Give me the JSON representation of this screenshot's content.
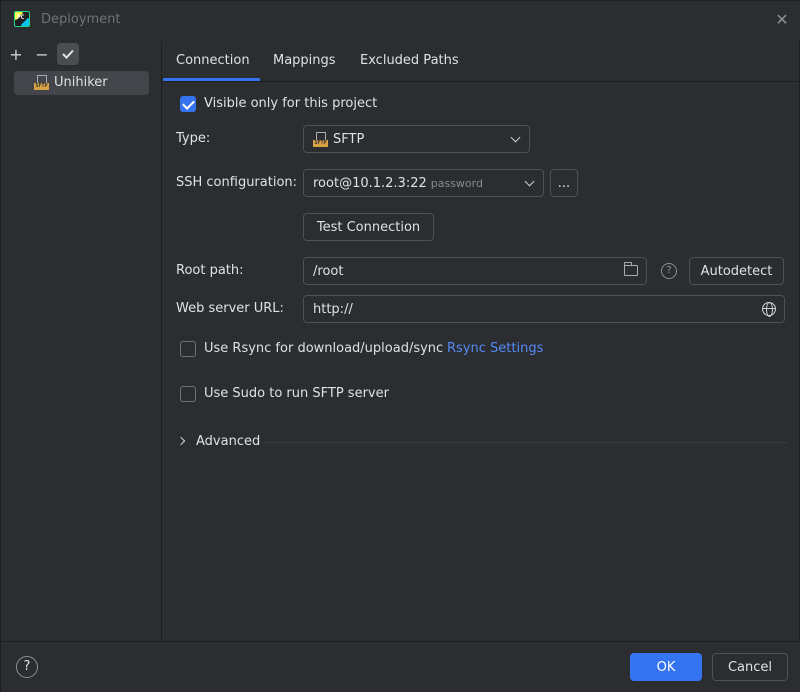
{
  "window": {
    "title": "Deployment"
  },
  "sidebar": {
    "tools": {
      "add": "+",
      "remove": "−"
    },
    "items": [
      {
        "label": "Unihiker",
        "icon": "sftp-icon",
        "icon_tag": "SFTP"
      }
    ]
  },
  "tabs": [
    {
      "label": "Connection",
      "selected": true
    },
    {
      "label": "Mappings"
    },
    {
      "label": "Excluded Paths"
    }
  ],
  "form": {
    "visible_only": {
      "label": "Visible only for this project",
      "checked": true
    },
    "type": {
      "label": "Type:",
      "value": "SFTP",
      "icon_tag": "SFTP"
    },
    "ssh": {
      "label": "SSH configuration:",
      "value": "root@10.1.2.3:22",
      "hint": "password",
      "more_label": "..."
    },
    "test_connection": {
      "label": "Test Connection"
    },
    "root_path": {
      "label": "Root path:",
      "value": "/root",
      "autodetect_label": "Autodetect",
      "help_glyph": "?"
    },
    "web_server_url": {
      "label": "Web server URL:",
      "value": "http://"
    },
    "rsync": {
      "label": "Use Rsync for download/upload/sync",
      "checked": false,
      "link": "Rsync Settings"
    },
    "sudo": {
      "label": "Use Sudo to run SFTP server",
      "checked": false
    },
    "advanced": {
      "label": "Advanced",
      "expanded": false
    }
  },
  "footer": {
    "help_glyph": "?",
    "ok_label": "OK",
    "cancel_label": "Cancel"
  },
  "colors": {
    "accent": "#3574f0",
    "link": "#548af7",
    "background": "#2b2d30",
    "selected_item": "#43454a"
  }
}
